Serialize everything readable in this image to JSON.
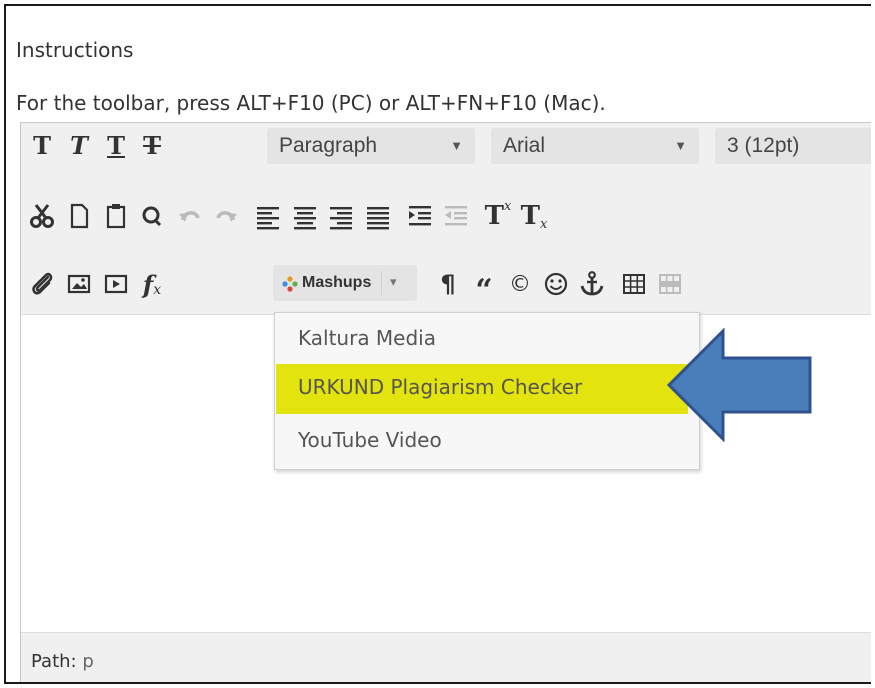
{
  "instructions": {
    "title": "Instructions",
    "hint": "For the toolbar, press ALT+F10 (PC) or ALT+FN+F10 (Mac)."
  },
  "toolbar": {
    "row1": {
      "buttons": [
        "bold-icon",
        "italic-icon",
        "underline-icon",
        "strikethrough-icon"
      ],
      "format_select": "Paragraph",
      "font_select": "Arial",
      "size_select": "3 (12pt)"
    },
    "row2": {
      "buttons": [
        "cut-icon",
        "copy-icon",
        "paste-icon",
        "find-icon",
        "undo-icon",
        "redo-icon",
        "align-left-icon",
        "align-center-icon",
        "align-right-icon",
        "align-justify-icon",
        "indent-icon",
        "outdent-icon",
        "superscript-icon",
        "subscript-icon"
      ]
    },
    "row3": {
      "buttons": [
        "attach-icon",
        "image-icon",
        "media-icon",
        "formula-icon",
        "paragraph-mark-icon",
        "quote-icon",
        "copyright-icon",
        "emoticon-icon",
        "anchor-icon",
        "table-icon",
        "table-disabled-icon"
      ],
      "mashups_label": "Mashups"
    },
    "glyphs": {
      "bold": "T",
      "italic": "T",
      "underline": "T",
      "strike": "T",
      "superscript_base": "T",
      "superscript": "x",
      "subscript_base": "T",
      "subscript": "x",
      "formula_f": "f",
      "formula_x": "x",
      "pilcrow": "¶",
      "quote": "“",
      "copyright": "©"
    }
  },
  "mashups_menu": {
    "items": [
      {
        "label": "Kaltura Media",
        "highlighted": false
      },
      {
        "label": "URKUND Plagiarism Checker",
        "highlighted": true
      },
      {
        "label": "YouTube Video",
        "highlighted": false
      }
    ],
    "highlight_color": "#e3e30d"
  },
  "path_bar": {
    "label": "Path:",
    "value": "p"
  },
  "callout_arrow": {
    "icon": "left-arrow-icon",
    "fill": "#4a7ebb",
    "stroke": "#2f528f"
  }
}
